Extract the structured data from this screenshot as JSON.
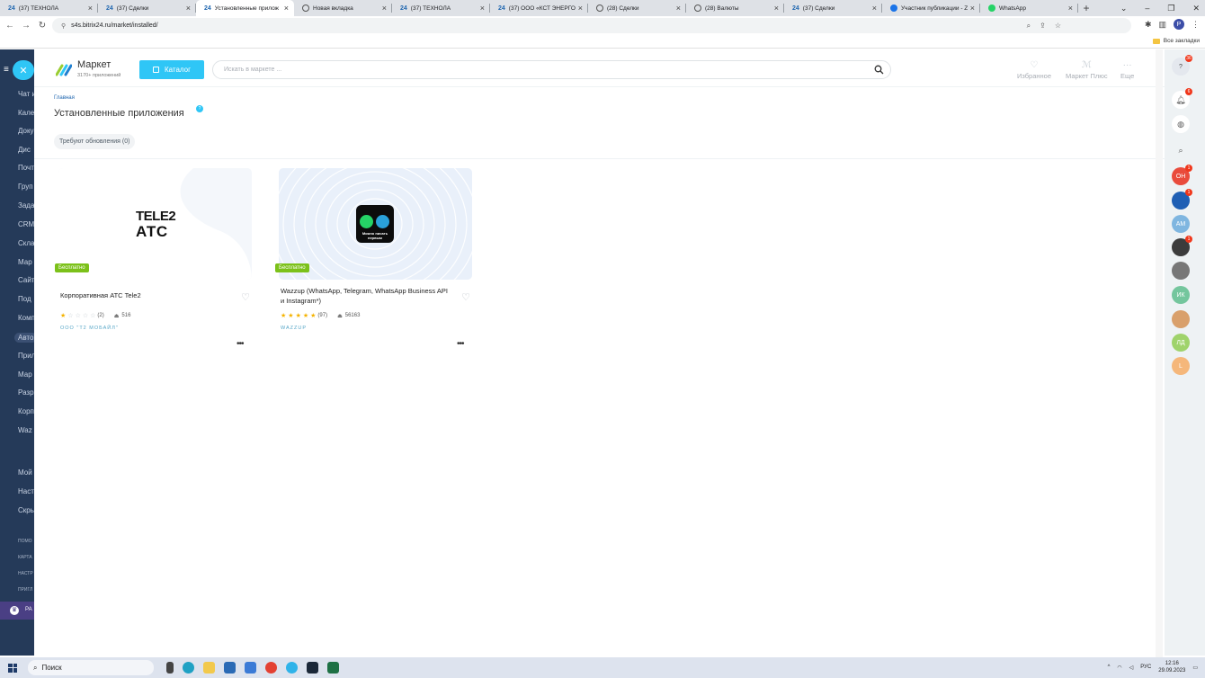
{
  "browser": {
    "tabs": [
      {
        "fav": "24",
        "title": "(37) ТЕХНОЛА",
        "active": false
      },
      {
        "fav": "24",
        "title": "(37) Сделки",
        "active": false
      },
      {
        "fav": "24",
        "title": "Установленные прилож",
        "active": true
      },
      {
        "fav": "globe",
        "title": "Новая вкладка",
        "active": false
      },
      {
        "fav": "24",
        "title": "(37) ТЕХНОЛА",
        "active": false
      },
      {
        "fav": "24",
        "title": "(37) ООО «КСТ ЭНЕРГО Н",
        "active": false
      },
      {
        "fav": "globe",
        "title": "(28) Сделки",
        "active": false
      },
      {
        "fav": "globe",
        "title": "(28) Валюты",
        "active": false
      },
      {
        "fav": "24",
        "title": "(37) Сделки",
        "active": false
      },
      {
        "fav": "z",
        "title": "Участник публикации - Z",
        "active": false
      },
      {
        "fav": "wa",
        "title": "WhatsApp",
        "active": false
      }
    ],
    "url": "s4s.bitrix24.ru/market/installed/",
    "profile_letter": "P",
    "bookmarks_label": "Все закладки"
  },
  "left_menu": {
    "items": [
      "Чат и",
      "Кале",
      "Доку",
      "Дис",
      "Почт",
      "Груп",
      "Зада",
      "CRM",
      "Скла",
      "Мар",
      "Сайт",
      "Под",
      "Комп",
      "Авто",
      "Прил",
      "Мар",
      "Разр",
      "Корп",
      "Waz",
      "Мой",
      "Наст",
      "Скры"
    ],
    "small_items": [
      "ПОМО",
      "КАРТА",
      "НАСТР",
      "ПРИГЛ"
    ],
    "bottom_label": "РА"
  },
  "market": {
    "title": "Маркет",
    "subtitle": "3170+ приложений",
    "catalog_label": "Каталог",
    "search_placeholder": "Искать в маркете ...",
    "favorites_label": "Избранное",
    "plus_label": "Маркет Плюс",
    "more_label": "Еще",
    "breadcrumb": "Главная",
    "page_title": "Установленные приложения",
    "title_badge": "?",
    "filter_chip": "Требуют обновления (0)",
    "free_badge": "Бесплатно",
    "cards": [
      {
        "name": "Корпоративная АТС Tele2",
        "rating": 1,
        "reviews": "(2)",
        "installs": "516",
        "developer": "ООО \"Т2 МОБАЙЛ\"",
        "logo_line1": "TELE2",
        "logo_line2": "АТС"
      },
      {
        "name": "Wazzup (WhatsApp, Telegram, WhatsApp Business API и Instagram*)",
        "rating": 5,
        "reviews": "(97)",
        "installs": "56163",
        "developer": "WAZZUP",
        "logo_text": "Можно писать первым"
      }
    ]
  },
  "right_panel": {
    "help_count": "36",
    "bell_count": "6",
    "avatars": [
      {
        "initials": "ОН",
        "color": "#e94b3c",
        "count": "1"
      },
      {
        "initials": "",
        "color": "#1f5fb4",
        "count": "1"
      },
      {
        "initials": "АМ",
        "color": "#7fb6e0",
        "count": ""
      },
      {
        "initials": "",
        "color": "#3c3c3c",
        "count": "1"
      },
      {
        "initials": "",
        "color": "#777777",
        "count": ""
      },
      {
        "initials": "ИК",
        "color": "#74c69d",
        "count": ""
      },
      {
        "initials": "",
        "color": "#d9a06b",
        "count": ""
      },
      {
        "initials": "ЛД",
        "color": "#9fd36b",
        "count": ""
      },
      {
        "initials": "L",
        "color": "#f5b77a",
        "count": ""
      }
    ]
  },
  "taskbar": {
    "search_label": "Поиск",
    "lang": "РУС",
    "time": "12:16",
    "date": "29.09.2023"
  }
}
